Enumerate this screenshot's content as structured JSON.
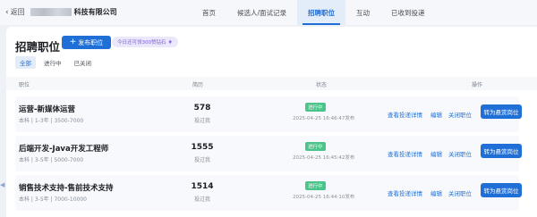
{
  "topbar": {
    "back_label": "返回",
    "company_name": "科技有限公司",
    "nav": [
      {
        "label": "首页",
        "active": false
      },
      {
        "label": "候选人/面试记录",
        "active": false
      },
      {
        "label": "招聘职位",
        "active": true
      },
      {
        "label": "互动",
        "active": false
      },
      {
        "label": "已收到投递",
        "active": false
      }
    ]
  },
  "header": {
    "title": "招聘职位",
    "publish_label": "发布职位",
    "quota_text": "今日还可领300赞钻石"
  },
  "filters": [
    {
      "label": "全部",
      "active": true
    },
    {
      "label": "进行中",
      "active": false
    },
    {
      "label": "已关闭",
      "active": false
    }
  ],
  "table": {
    "columns": {
      "position": "职位",
      "applications": "简历",
      "status": "状态",
      "actions": "操作"
    },
    "rows": [
      {
        "title": "运营-新媒体运营",
        "meta": "本科 | 1-3年 | 3500-7000",
        "count": "578",
        "count_label": "投过我",
        "status": "进行中",
        "time": "2025-04-25 16:46:47发布",
        "link_detail": "查看投递详情",
        "link_edit": "编辑",
        "link_close": "关闭职位",
        "cta": "转为悬赏岗位"
      },
      {
        "title": "后端开发-Java开发工程师",
        "meta": "本科 | 3-5年 | 5000-7000",
        "count": "1555",
        "count_label": "投过我",
        "status": "进行中",
        "time": "2025-04-25 16:45:42发布",
        "link_detail": "查看投递详情",
        "link_edit": "编辑",
        "link_close": "关闭职位",
        "cta": "转为悬赏岗位"
      },
      {
        "title": "销售技术支持-售前技术支持",
        "meta": "本科 | 3-5年 | 7000-10000",
        "count": "1514",
        "count_label": "投过我",
        "status": "进行中",
        "time": "2025-04-25 16:44:10发布",
        "link_detail": "查看投递详情",
        "link_edit": "编辑",
        "link_close": "关闭职位",
        "cta": "转为悬赏岗位"
      }
    ]
  },
  "colors": {
    "accent": "#1f6fd6",
    "status_green": "#4cc38a",
    "quota_purple": "#7b5fd4"
  }
}
